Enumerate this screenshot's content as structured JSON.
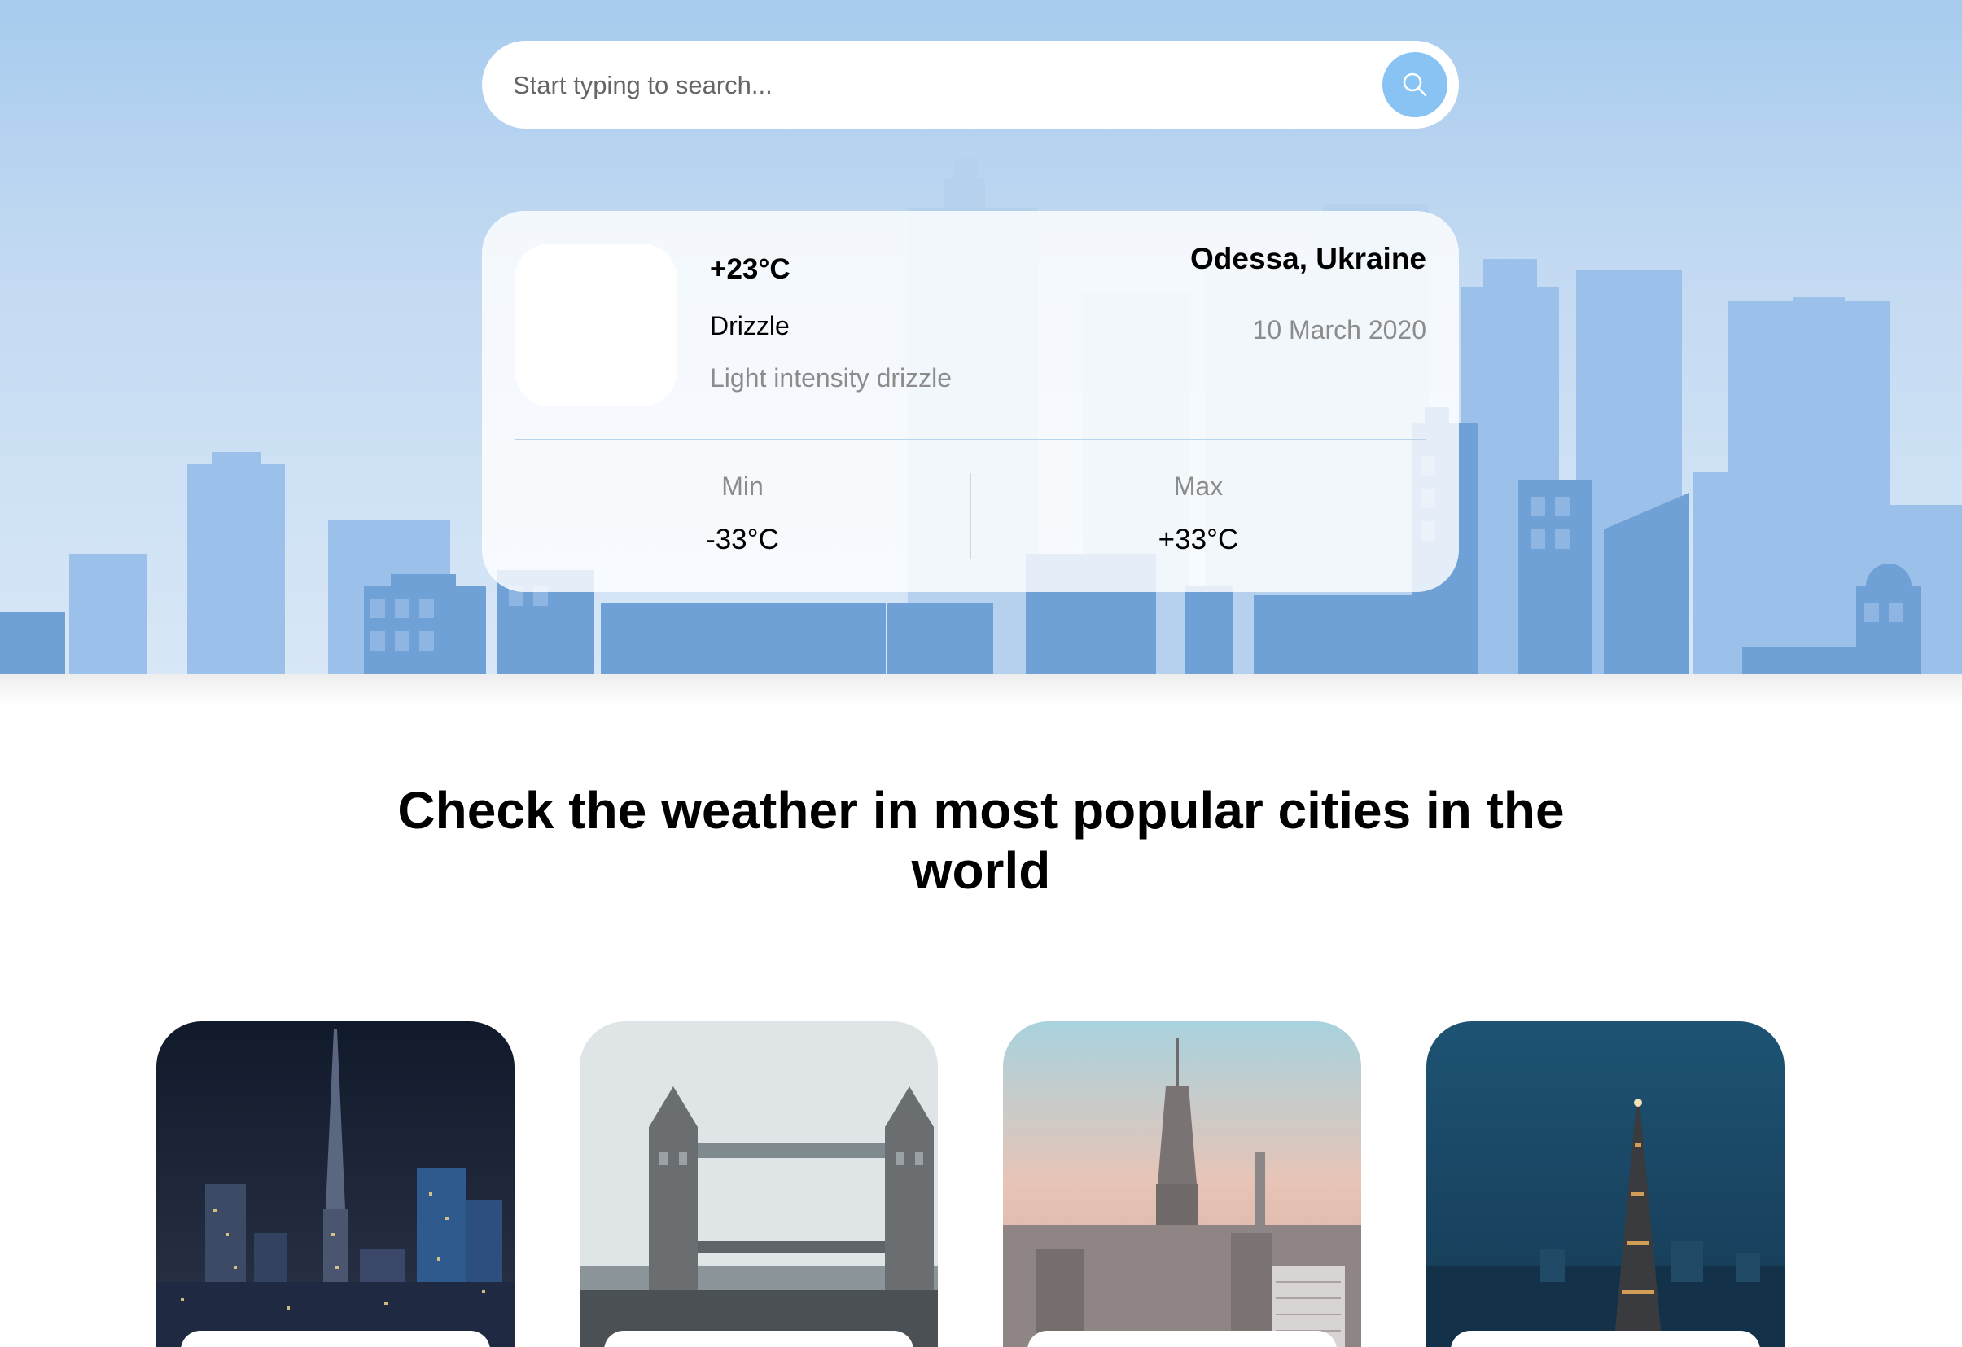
{
  "search": {
    "placeholder": "Start typing to search..."
  },
  "weather": {
    "temperature": "+23°C",
    "condition": "Drizzle",
    "description": "Light intensity drizzle",
    "location": "Odessa, Ukraine",
    "date": "10 March 2020",
    "min_label": "Min",
    "min_value": "-33°C",
    "max_label": "Max",
    "max_value": "+33°C"
  },
  "popular": {
    "title": "Check the weather in most popular cities in the world"
  },
  "colors": {
    "accent": "#88c3f3",
    "hero_sky": "#a7cbee",
    "skyline": "#6fa0d6"
  },
  "icons": {
    "search": "search-icon"
  }
}
